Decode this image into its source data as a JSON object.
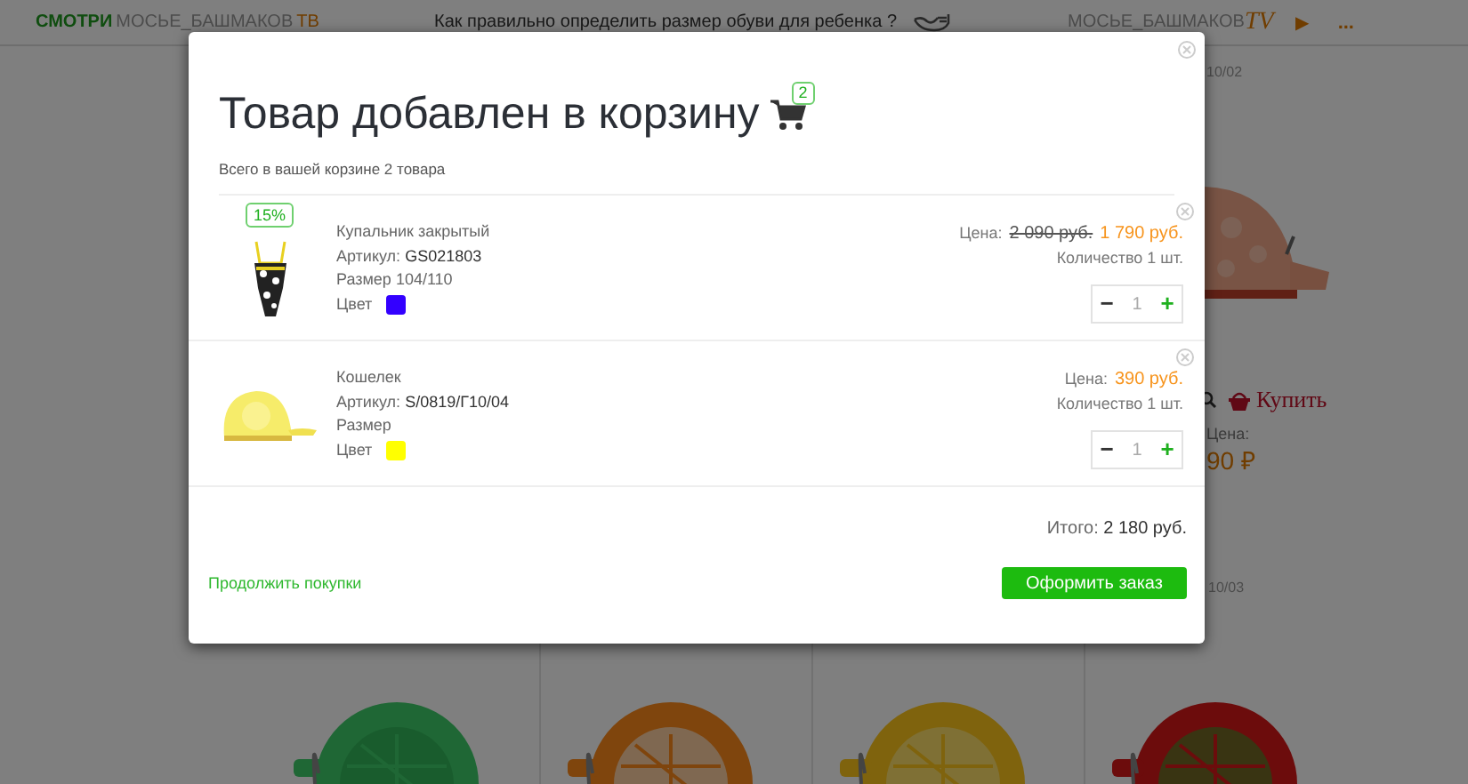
{
  "top_bar": {
    "promo": {
      "prefix": "СМОТРИ",
      "name": "МОСЬЕ_БАШМАКОВ",
      "suffix": "ТВ"
    },
    "headline": "Как правильно определить размер обуви для ребенка ?",
    "channel": {
      "name": "МОСЬЕ_БАШМАКОВ",
      "logo": "TV"
    },
    "play": "▶",
    "more": "..."
  },
  "catalog": {
    "top_card": {
      "date": "10/02",
      "buy": "Купить",
      "price_label": "Цена:",
      "price": "90 ₽"
    },
    "bottom_cards": [
      {
        "kind": "picture"
      },
      {
        "kind": "picture"
      },
      {
        "kind": "picture"
      },
      {
        "kind": "picture",
        "date": "10/03"
      }
    ]
  },
  "modal": {
    "title": "Товар добавлен в корзину",
    "cart_count": "2",
    "summary": "Всего в вашей корзине 2 товара",
    "items": [
      {
        "discount": "15%",
        "name": "Купальник закрытый",
        "article_label": "Артикул:",
        "article": "GS021803",
        "size_label": "Размер",
        "size": "104/110",
        "color_label": "Цвет",
        "color": "#3300ff",
        "price_label": "Цена:",
        "old_price": "2 090 руб.",
        "price": "1 790 руб.",
        "quantity_text": "Количество 1 шт.",
        "quantity": "1",
        "minus": "−",
        "plus": "+"
      },
      {
        "name": "Кошелек",
        "article_label": "Артикул:",
        "article": "S/0819/Г10/04",
        "size_label": "Размер",
        "color_label": "Цвет",
        "color": "#ffff00",
        "price_label": "Цена:",
        "price": "390 руб.",
        "quantity_text": "Количество 1 шт.",
        "quantity": "1",
        "minus": "−",
        "plus": "+"
      }
    ],
    "total_label": "Итого:",
    "total": "2 180 руб.",
    "continue_link": "Продолжить покупки",
    "checkout_button": "Оформить заказ"
  }
}
